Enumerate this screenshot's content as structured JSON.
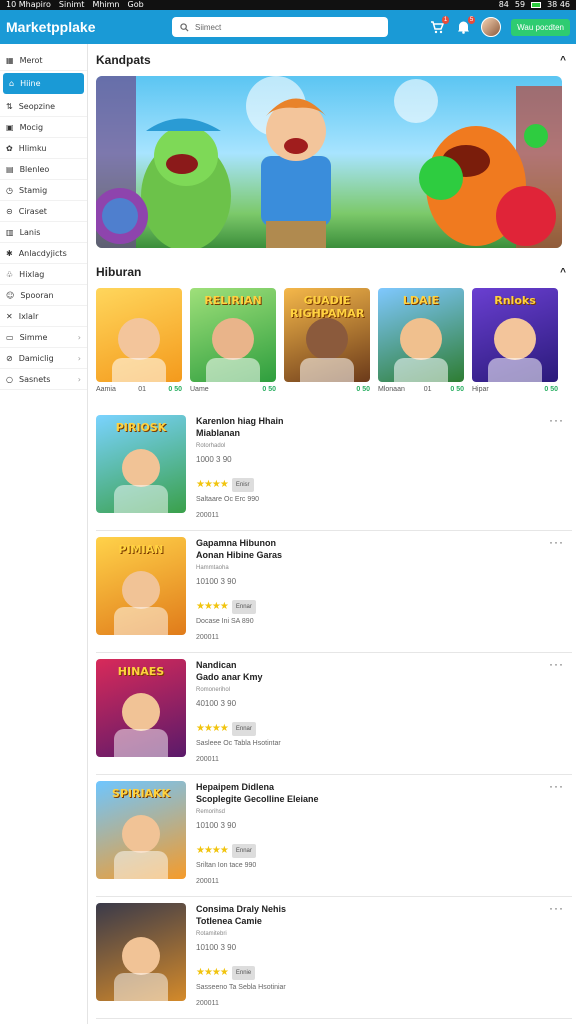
{
  "status_bar": {
    "left": [
      "10 Mhapiro",
      "Sinimt",
      "Mhimn",
      "Gob"
    ],
    "right": [
      "84",
      "59",
      "38 46"
    ]
  },
  "app": {
    "title": "Marketpplake"
  },
  "search": {
    "placeholder": "Siimect"
  },
  "header": {
    "cart_badge": "1",
    "notif_badge": "5",
    "cta_label": "Wau pocdten"
  },
  "sidebar": {
    "items": [
      {
        "icon": "grid-icon",
        "label": "Merot"
      },
      {
        "icon": "home-icon",
        "label": "Hiine",
        "active": true
      },
      {
        "icon": "chart-icon",
        "label": "Seopzine"
      },
      {
        "icon": "box-icon",
        "label": "Mocig"
      },
      {
        "icon": "gift-icon",
        "label": "Hlimku"
      },
      {
        "icon": "bag-icon",
        "label": "Blenleo"
      },
      {
        "icon": "clock-icon",
        "label": "Stamig"
      },
      {
        "icon": "shield-icon",
        "label": "Ciraset"
      },
      {
        "icon": "doc-icon",
        "label": "Lanis"
      },
      {
        "icon": "gear-icon",
        "label": "Anlacdyjicts"
      },
      {
        "icon": "tag-icon",
        "label": "Hixlag"
      },
      {
        "icon": "users-icon",
        "label": "Spooran"
      },
      {
        "icon": "tools-icon",
        "label": "Ixlalr"
      },
      {
        "icon": "chat-icon",
        "label": "Simme",
        "chevron": true
      },
      {
        "icon": "link-icon",
        "label": "Damiclig",
        "chevron": true
      },
      {
        "icon": "circle-icon",
        "label": "Sasnets",
        "chevron": true
      }
    ]
  },
  "section_featured": {
    "title": "Kandpats"
  },
  "section_games": {
    "title": "Hiburan"
  },
  "games": [
    {
      "art": "",
      "name": "Aamia",
      "badge": "01",
      "price": "0 50"
    },
    {
      "art": "RELIRIAN",
      "name": "Uame",
      "badge": "",
      "price": "0 50"
    },
    {
      "art": "GUADIE RIGHPAMAR",
      "name": "",
      "badge": "",
      "price": "0 50"
    },
    {
      "art": "LDAIE",
      "name": "Mlonaan",
      "badge": "01",
      "price": "0 50"
    },
    {
      "art": "Rnloks",
      "name": "Hipar",
      "badge": "",
      "price": "0 50"
    }
  ],
  "list": [
    {
      "art": "PIRIOSK",
      "title1": "Karenlon hiag Hhain",
      "title2": "Miablanan",
      "sub": "Rotorhadol",
      "num": "1000 3 90",
      "tag": "Enisr",
      "desc": "Saltaare Oc Erc 990",
      "code": "200011"
    },
    {
      "art": "PIMIAN",
      "title1": "Gapamna Hibunon",
      "title2": "Aonan Hibine Garas",
      "sub": "Hammtaoha",
      "num": "10100 3 90",
      "tag": "Ennar",
      "desc": "Docase Ini SA 890",
      "code": "200011"
    },
    {
      "art": "HINAES",
      "title1": "Nandican",
      "title2": "Gado anar Kmy",
      "sub": "Romonerihol",
      "num": "40100 3 90",
      "tag": "Ennar",
      "desc": "Sasleee Oc Tabla Hsotintar",
      "code": "200011"
    },
    {
      "art": "SPIRIAKK",
      "title1": "Hepaipem Didlena",
      "title2": "Scoplegite Gecolline Eleiane",
      "sub": "Remorihsd",
      "num": "10100 3 90",
      "tag": "Ennar",
      "desc": "Sriltan Ion tace 990",
      "code": "200011"
    },
    {
      "art": "",
      "title1": "Consima Draly Nehis",
      "title2": "Totlenea Camie",
      "sub": "Rotamitebri",
      "num": "10100 3 90",
      "tag": "Ennie",
      "desc": "Sasseeno Ta Sebla Hsotiniar",
      "code": "200011"
    }
  ],
  "colors": {
    "primary": "#1a9ad6",
    "accent": "#2ecc71",
    "star": "#f1c40f"
  }
}
